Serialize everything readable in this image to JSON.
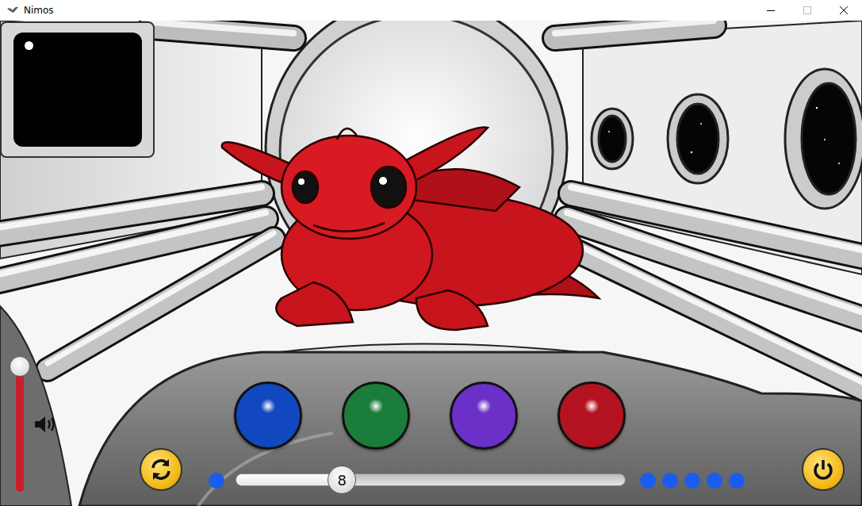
{
  "window": {
    "title": "Nimos"
  },
  "minimap": {
    "dot_visible": true
  },
  "volume": {
    "level": 1.0
  },
  "color_buttons": [
    {
      "name": "blue",
      "color": "#1148c0"
    },
    {
      "name": "green",
      "color": "#1b7d3c"
    },
    {
      "name": "purple",
      "color": "#6a30c8"
    },
    {
      "name": "red",
      "color": "#b3121f"
    }
  ],
  "slider": {
    "reading": "8",
    "level": 0.27
  },
  "left_dots": [
    {
      "on": true
    }
  ],
  "right_dots": [
    {
      "on": true
    },
    {
      "on": true
    },
    {
      "on": true
    },
    {
      "on": true
    },
    {
      "on": true
    }
  ]
}
